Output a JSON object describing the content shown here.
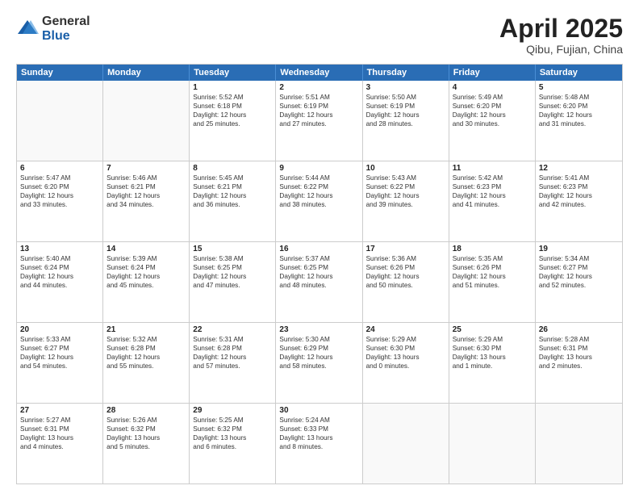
{
  "logo": {
    "general": "General",
    "blue": "Blue"
  },
  "title": "April 2025",
  "subtitle": "Qibu, Fujian, China",
  "header_days": [
    "Sunday",
    "Monday",
    "Tuesday",
    "Wednesday",
    "Thursday",
    "Friday",
    "Saturday"
  ],
  "weeks": [
    [
      {
        "day": "",
        "lines": []
      },
      {
        "day": "",
        "lines": []
      },
      {
        "day": "1",
        "lines": [
          "Sunrise: 5:52 AM",
          "Sunset: 6:18 PM",
          "Daylight: 12 hours",
          "and 25 minutes."
        ]
      },
      {
        "day": "2",
        "lines": [
          "Sunrise: 5:51 AM",
          "Sunset: 6:19 PM",
          "Daylight: 12 hours",
          "and 27 minutes."
        ]
      },
      {
        "day": "3",
        "lines": [
          "Sunrise: 5:50 AM",
          "Sunset: 6:19 PM",
          "Daylight: 12 hours",
          "and 28 minutes."
        ]
      },
      {
        "day": "4",
        "lines": [
          "Sunrise: 5:49 AM",
          "Sunset: 6:20 PM",
          "Daylight: 12 hours",
          "and 30 minutes."
        ]
      },
      {
        "day": "5",
        "lines": [
          "Sunrise: 5:48 AM",
          "Sunset: 6:20 PM",
          "Daylight: 12 hours",
          "and 31 minutes."
        ]
      }
    ],
    [
      {
        "day": "6",
        "lines": [
          "Sunrise: 5:47 AM",
          "Sunset: 6:20 PM",
          "Daylight: 12 hours",
          "and 33 minutes."
        ]
      },
      {
        "day": "7",
        "lines": [
          "Sunrise: 5:46 AM",
          "Sunset: 6:21 PM",
          "Daylight: 12 hours",
          "and 34 minutes."
        ]
      },
      {
        "day": "8",
        "lines": [
          "Sunrise: 5:45 AM",
          "Sunset: 6:21 PM",
          "Daylight: 12 hours",
          "and 36 minutes."
        ]
      },
      {
        "day": "9",
        "lines": [
          "Sunrise: 5:44 AM",
          "Sunset: 6:22 PM",
          "Daylight: 12 hours",
          "and 38 minutes."
        ]
      },
      {
        "day": "10",
        "lines": [
          "Sunrise: 5:43 AM",
          "Sunset: 6:22 PM",
          "Daylight: 12 hours",
          "and 39 minutes."
        ]
      },
      {
        "day": "11",
        "lines": [
          "Sunrise: 5:42 AM",
          "Sunset: 6:23 PM",
          "Daylight: 12 hours",
          "and 41 minutes."
        ]
      },
      {
        "day": "12",
        "lines": [
          "Sunrise: 5:41 AM",
          "Sunset: 6:23 PM",
          "Daylight: 12 hours",
          "and 42 minutes."
        ]
      }
    ],
    [
      {
        "day": "13",
        "lines": [
          "Sunrise: 5:40 AM",
          "Sunset: 6:24 PM",
          "Daylight: 12 hours",
          "and 44 minutes."
        ]
      },
      {
        "day": "14",
        "lines": [
          "Sunrise: 5:39 AM",
          "Sunset: 6:24 PM",
          "Daylight: 12 hours",
          "and 45 minutes."
        ]
      },
      {
        "day": "15",
        "lines": [
          "Sunrise: 5:38 AM",
          "Sunset: 6:25 PM",
          "Daylight: 12 hours",
          "and 47 minutes."
        ]
      },
      {
        "day": "16",
        "lines": [
          "Sunrise: 5:37 AM",
          "Sunset: 6:25 PM",
          "Daylight: 12 hours",
          "and 48 minutes."
        ]
      },
      {
        "day": "17",
        "lines": [
          "Sunrise: 5:36 AM",
          "Sunset: 6:26 PM",
          "Daylight: 12 hours",
          "and 50 minutes."
        ]
      },
      {
        "day": "18",
        "lines": [
          "Sunrise: 5:35 AM",
          "Sunset: 6:26 PM",
          "Daylight: 12 hours",
          "and 51 minutes."
        ]
      },
      {
        "day": "19",
        "lines": [
          "Sunrise: 5:34 AM",
          "Sunset: 6:27 PM",
          "Daylight: 12 hours",
          "and 52 minutes."
        ]
      }
    ],
    [
      {
        "day": "20",
        "lines": [
          "Sunrise: 5:33 AM",
          "Sunset: 6:27 PM",
          "Daylight: 12 hours",
          "and 54 minutes."
        ]
      },
      {
        "day": "21",
        "lines": [
          "Sunrise: 5:32 AM",
          "Sunset: 6:28 PM",
          "Daylight: 12 hours",
          "and 55 minutes."
        ]
      },
      {
        "day": "22",
        "lines": [
          "Sunrise: 5:31 AM",
          "Sunset: 6:28 PM",
          "Daylight: 12 hours",
          "and 57 minutes."
        ]
      },
      {
        "day": "23",
        "lines": [
          "Sunrise: 5:30 AM",
          "Sunset: 6:29 PM",
          "Daylight: 12 hours",
          "and 58 minutes."
        ]
      },
      {
        "day": "24",
        "lines": [
          "Sunrise: 5:29 AM",
          "Sunset: 6:30 PM",
          "Daylight: 13 hours",
          "and 0 minutes."
        ]
      },
      {
        "day": "25",
        "lines": [
          "Sunrise: 5:29 AM",
          "Sunset: 6:30 PM",
          "Daylight: 13 hours",
          "and 1 minute."
        ]
      },
      {
        "day": "26",
        "lines": [
          "Sunrise: 5:28 AM",
          "Sunset: 6:31 PM",
          "Daylight: 13 hours",
          "and 2 minutes."
        ]
      }
    ],
    [
      {
        "day": "27",
        "lines": [
          "Sunrise: 5:27 AM",
          "Sunset: 6:31 PM",
          "Daylight: 13 hours",
          "and 4 minutes."
        ]
      },
      {
        "day": "28",
        "lines": [
          "Sunrise: 5:26 AM",
          "Sunset: 6:32 PM",
          "Daylight: 13 hours",
          "and 5 minutes."
        ]
      },
      {
        "day": "29",
        "lines": [
          "Sunrise: 5:25 AM",
          "Sunset: 6:32 PM",
          "Daylight: 13 hours",
          "and 6 minutes."
        ]
      },
      {
        "day": "30",
        "lines": [
          "Sunrise: 5:24 AM",
          "Sunset: 6:33 PM",
          "Daylight: 13 hours",
          "and 8 minutes."
        ]
      },
      {
        "day": "",
        "lines": []
      },
      {
        "day": "",
        "lines": []
      },
      {
        "day": "",
        "lines": []
      }
    ]
  ]
}
